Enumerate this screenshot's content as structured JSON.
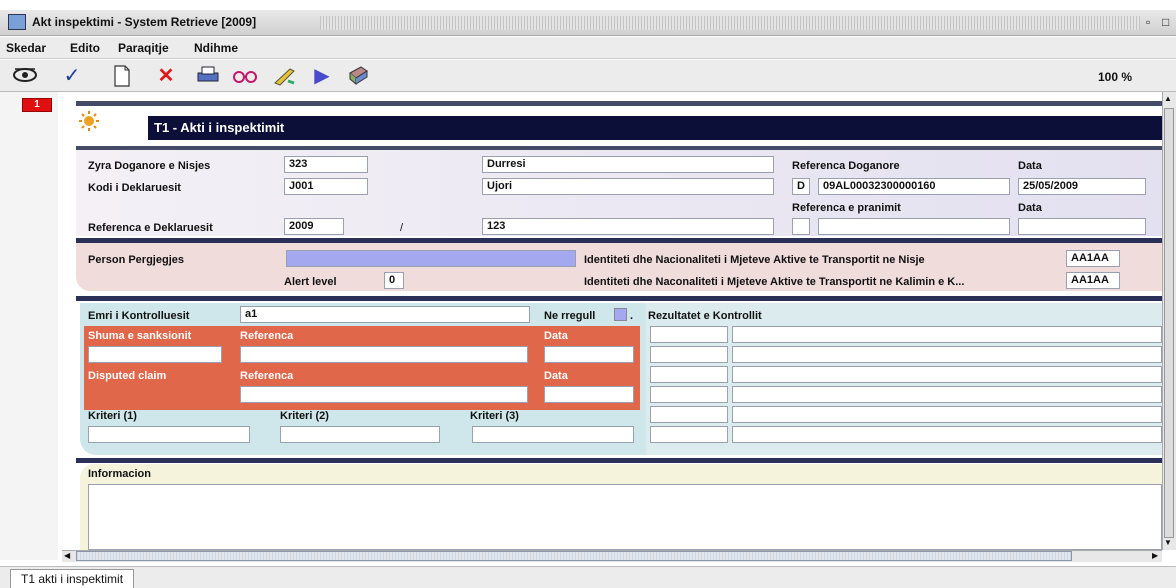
{
  "window": {
    "title": "Akt inspektimi  - System Retrieve [2009]",
    "min_glyph": "▫",
    "close_glyph": "□"
  },
  "menu": [
    "Skedar",
    "Edito",
    "Paraqitje",
    "Ndihme"
  ],
  "toolbar": {
    "icons": [
      "eye-icon",
      "check-icon",
      "new-document-icon",
      "delete-icon",
      "print-icon",
      "glasses-icon",
      "tools-icon",
      "play-icon",
      "book-icon"
    ],
    "zoom": "100 %"
  },
  "page_badge": "1",
  "form": {
    "title": "T1 - Akti i inspektimit",
    "zyra_label": "Zyra Doganore e Nisjes",
    "zyra_code": "323",
    "zyra_name": "Durresi",
    "ref_doganore_label": "Referenca Doganore",
    "data_label_1": "Data",
    "kodi_label": "Kodi i Deklaruesit",
    "kodi_code": "J001",
    "kodi_name": "Ujori",
    "ref_d": "D",
    "ref_number": "09AL00032300000160",
    "ref_date": "25/05/2009",
    "ref_pranimit_label": "Referenca e pranimit",
    "data_label_2": "Data",
    "ref_deklaruesit_label": "Referenca e Deklaruesit",
    "ref_year": "2009",
    "slash": "/",
    "ref_value": "123",
    "person_label": "Person Pergjegjes",
    "person_value": "",
    "alert_label": "Alert level",
    "alert_value": "0",
    "ident_nisje_label": "Identiteti dhe Nacionaliteti i Mjeteve Aktive te Transportit ne Nisje",
    "ident_nisje_value": "AA1AA",
    "ident_kalim_label": "Identiteti dhe Naconaliteti i Mjeteve Aktive te Transportit ne Kalimin e K...",
    "ident_kalim_value": "AA1AA",
    "emri_label": "Emri i Kontrolluesit",
    "emri_value": "a1",
    "ne_rregull_label": "Ne rregull",
    "ne_rregull_dot": ".",
    "rezultatet_label": "Rezultatet e Kontrollit",
    "shuma_label": "Shuma e sanksionit",
    "referenca_label_1": "Referenca",
    "data_label_3": "Data",
    "disputed_label": "Disputed claim",
    "referenca_label_2": "Referenca",
    "data_label_4": "Data",
    "kriteri1_label": "Kriteri (1)",
    "kriteri2_label": "Kriteri (2)",
    "kriteri3_label": "Kriteri (3)",
    "informacion_label": "Informacion"
  },
  "status": {
    "tab": "T1 akti i inspektimit"
  },
  "scroll": {
    "left_arrow": "◀",
    "right_arrow": "▶",
    "up_arrow": "▲",
    "down_arrow": "▼"
  },
  "colors": {
    "header_band": "#0c1038",
    "pink_panel": "#f1dcdc",
    "cyan_panel": "#cfe7ea",
    "orange_panel": "#e0674a",
    "yellow_panel": "#f5f3dc",
    "person_field": "#a4a8ef"
  }
}
